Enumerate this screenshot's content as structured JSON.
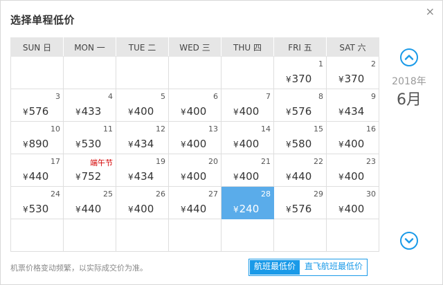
{
  "title": "选择单程低价",
  "close_icon": "×",
  "weekdays": [
    "SUN 日",
    "MON 一",
    "TUE 二",
    "WED 三",
    "THU 四",
    "FRI 五",
    "SAT 六"
  ],
  "currency": "¥",
  "year_label": "2018年",
  "month_label": "6月",
  "days": [
    {
      "day": "1",
      "price": "370",
      "col": 5
    },
    {
      "day": "2",
      "price": "370"
    },
    {
      "day": "3",
      "price": "576"
    },
    {
      "day": "4",
      "price": "433"
    },
    {
      "day": "5",
      "price": "400"
    },
    {
      "day": "6",
      "price": "400"
    },
    {
      "day": "7",
      "price": "400"
    },
    {
      "day": "8",
      "price": "576"
    },
    {
      "day": "9",
      "price": "434"
    },
    {
      "day": "10",
      "price": "890"
    },
    {
      "day": "11",
      "price": "530"
    },
    {
      "day": "12",
      "price": "434"
    },
    {
      "day": "13",
      "price": "400"
    },
    {
      "day": "14",
      "price": "400"
    },
    {
      "day": "15",
      "price": "580"
    },
    {
      "day": "16",
      "price": "400"
    },
    {
      "day": "17",
      "price": "440"
    },
    {
      "day": "端午节",
      "price": "752",
      "holiday": true
    },
    {
      "day": "19",
      "price": "434"
    },
    {
      "day": "20",
      "price": "400"
    },
    {
      "day": "21",
      "price": "400"
    },
    {
      "day": "22",
      "price": "440"
    },
    {
      "day": "23",
      "price": "400"
    },
    {
      "day": "24",
      "price": "530"
    },
    {
      "day": "25",
      "price": "440"
    },
    {
      "day": "26",
      "price": "400"
    },
    {
      "day": "27",
      "price": "440"
    },
    {
      "day": "28",
      "price": "240",
      "selected": true
    },
    {
      "day": "29",
      "price": "576"
    },
    {
      "day": "30",
      "price": "400"
    }
  ],
  "footer": {
    "note": "机票价格变动频繁，以实际成交价为准。",
    "options": [
      "航班最低价",
      "直飞航班最低价"
    ],
    "active_option": "航班最低价"
  },
  "colors": {
    "accent": "#1a9ae8",
    "selected_cell": "#5aacea",
    "holiday": "#d40000"
  },
  "icons": {
    "prev": "chevron-up-icon",
    "next": "chevron-down-icon"
  }
}
